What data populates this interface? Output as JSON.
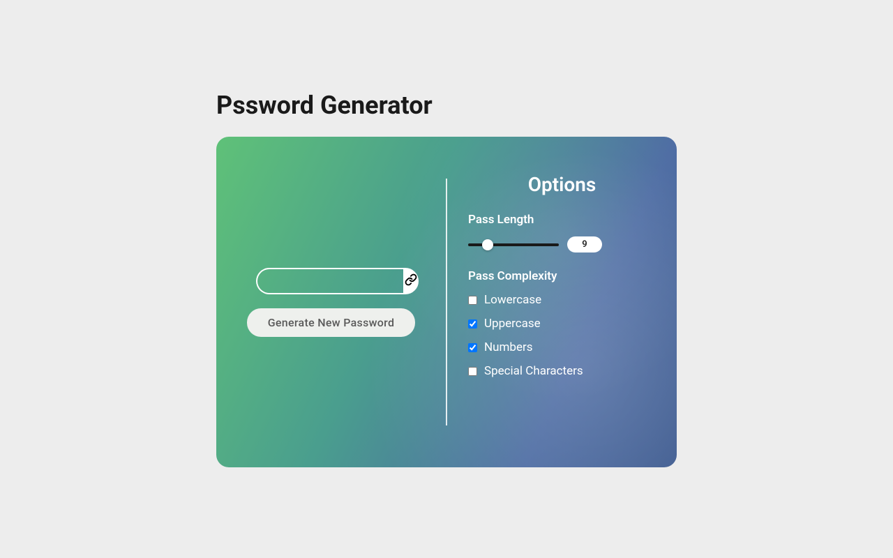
{
  "title": "Pssword Generator",
  "generateButton": "Generate New Password",
  "passwordValue": "",
  "options": {
    "heading": "Options",
    "lengthLabel": "Pass Length",
    "lengthValue": "9",
    "complexityLabel": "Pass Complexity",
    "checkboxes": {
      "lowercase": {
        "label": "Lowercase",
        "checked": false
      },
      "uppercase": {
        "label": "Uppercase",
        "checked": true
      },
      "numbers": {
        "label": "Numbers",
        "checked": true
      },
      "special": {
        "label": "Special Characters",
        "checked": false
      }
    }
  }
}
